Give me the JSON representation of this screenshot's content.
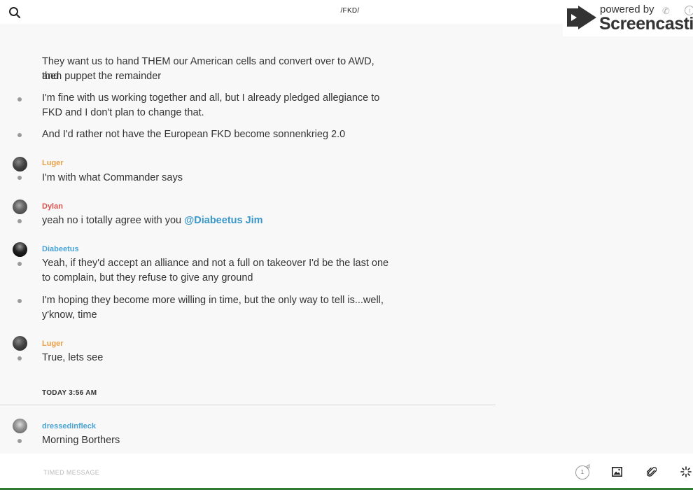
{
  "header": {
    "channel_title": "/FKD/",
    "search_icon": "search-icon"
  },
  "watermark": {
    "small": "powered by",
    "big": "Screencastify",
    "info": "i"
  },
  "messages": {
    "m1": {
      "line1": "They want us to hand THEM our American cells and convert over to AWD, and",
      "line2": "then puppet the remainder"
    },
    "m2": {
      "line1": "I'm fine with us working together and all, but I already pledged allegiance to",
      "line2": "FKD and I don't plan to change that."
    },
    "m3": {
      "text": "And I'd rather not have the European FKD become sonnenkrieg 2.0"
    },
    "g_luger1": {
      "author": "Luger",
      "author_color": "#e8a04a",
      "text": "I'm with what Commander says"
    },
    "g_dylan": {
      "author": "Dylan",
      "author_color": "#d9534f",
      "text": "yeah no i totally agree with you ",
      "mention": "@Diabeetus Jim"
    },
    "g_diabeetus": {
      "author": "Diabeetus",
      "author_color": "#4aa3d4",
      "m1_line1": "Yeah, if they'd accept an alliance and not a full on takeover I'd be the last one",
      "m1_line2": "to complain, but they refuse to give any ground",
      "m2_line1": "I'm hoping they become more willing in time, but the only way to tell is...well,",
      "m2_line2": "y'know, time"
    },
    "g_luger2": {
      "author": "Luger",
      "author_color": "#e8a04a",
      "text": "True, lets see"
    },
    "divider": "TODAY 3:56 AM",
    "g_dressed": {
      "author": "dressedinfleck",
      "author_color": "#4aa3d4",
      "text": "Morning Borthers"
    }
  },
  "composer": {
    "placeholder": "TIMED MESSAGE",
    "timer_value": "1",
    "timer_unit": "d",
    "icons": [
      "timer-icon",
      "image-icon",
      "paperclip-icon",
      "sparkle-icon"
    ]
  }
}
